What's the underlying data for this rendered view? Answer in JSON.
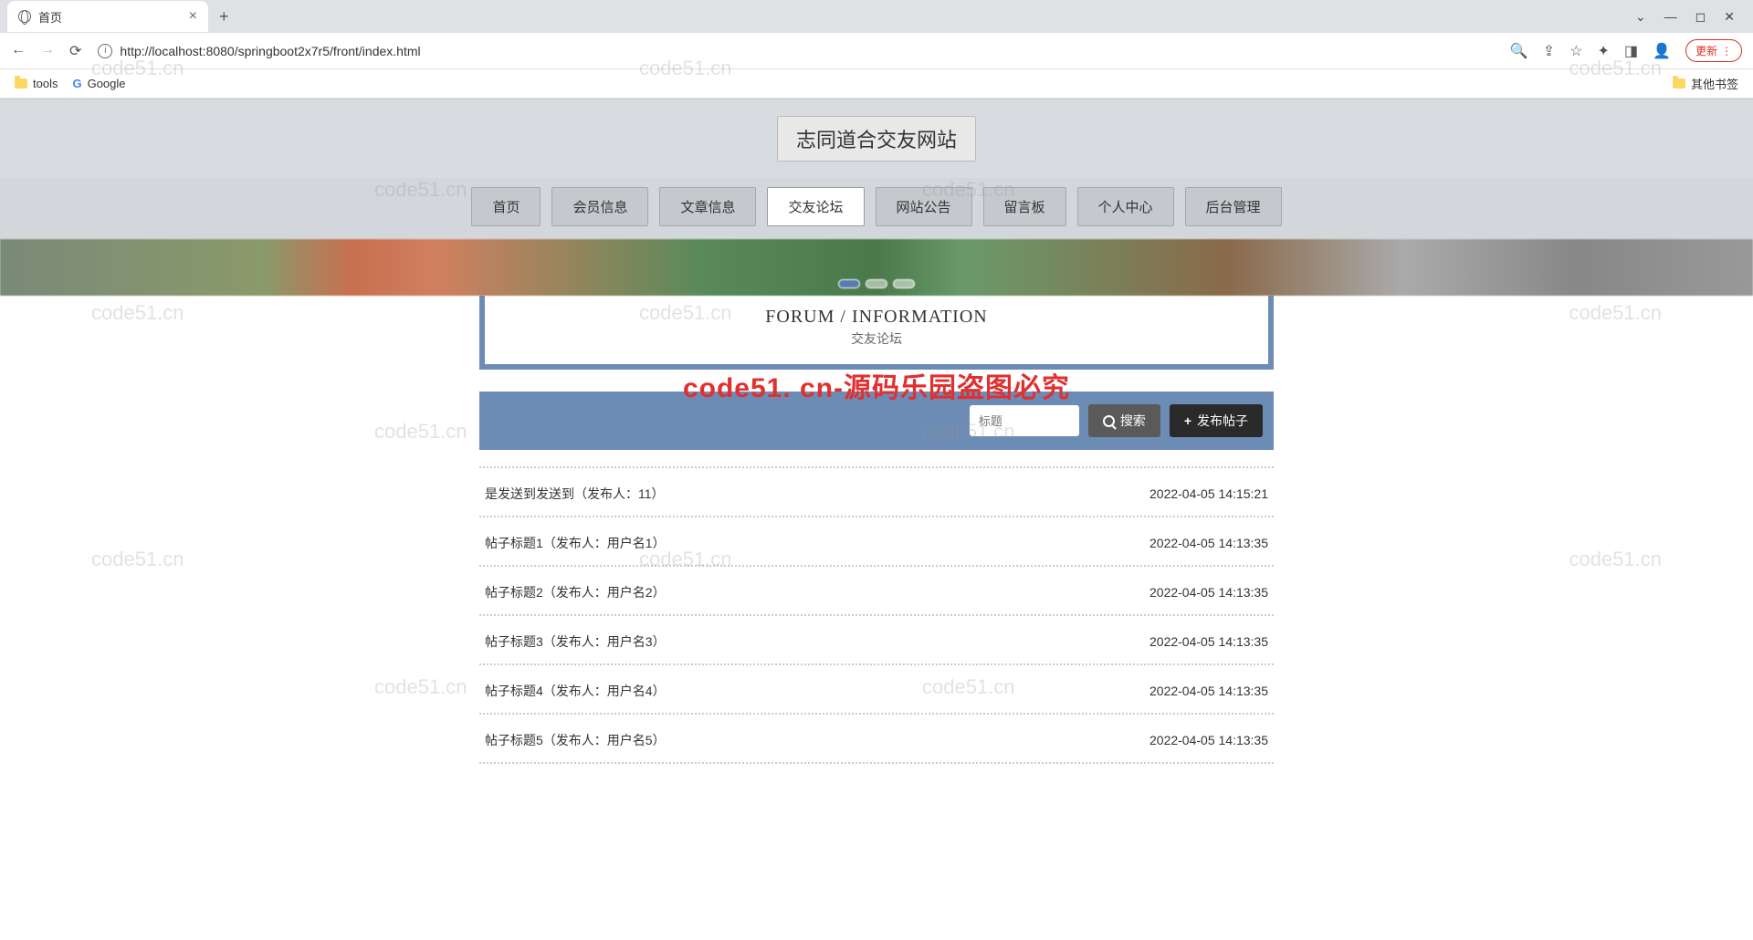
{
  "browser": {
    "tab_title": "首页",
    "url": "http://localhost:8080/springboot2x7r5/front/index.html",
    "update_label": "更新",
    "bookmarks": {
      "tools": "tools",
      "google": "Google",
      "other": "其他书签"
    }
  },
  "site": {
    "title": "志同道合交友网站"
  },
  "nav": {
    "items": [
      "首页",
      "会员信息",
      "文章信息",
      "交友论坛",
      "网站公告",
      "留言板",
      "个人中心",
      "后台管理"
    ],
    "active_index": 3
  },
  "forum": {
    "heading_en": "FORUM / INFORMATION",
    "heading_cn": "交友论坛",
    "search_placeholder": "标题",
    "search_btn": "搜索",
    "post_btn": "发布帖子"
  },
  "posts": [
    {
      "title": "是发送到发送到（发布人：11）",
      "date": "2022-04-05 14:15:21"
    },
    {
      "title": "帖子标题1（发布人：用户名1）",
      "date": "2022-04-05 14:13:35"
    },
    {
      "title": "帖子标题2（发布人：用户名2）",
      "date": "2022-04-05 14:13:35"
    },
    {
      "title": "帖子标题3（发布人：用户名3）",
      "date": "2022-04-05 14:13:35"
    },
    {
      "title": "帖子标题4（发布人：用户名4）",
      "date": "2022-04-05 14:13:35"
    },
    {
      "title": "帖子标题5（发布人：用户名5）",
      "date": "2022-04-05 14:13:35"
    }
  ],
  "watermark": {
    "text": "code51.cn",
    "red": "code51. cn-源码乐园盗图必究"
  }
}
